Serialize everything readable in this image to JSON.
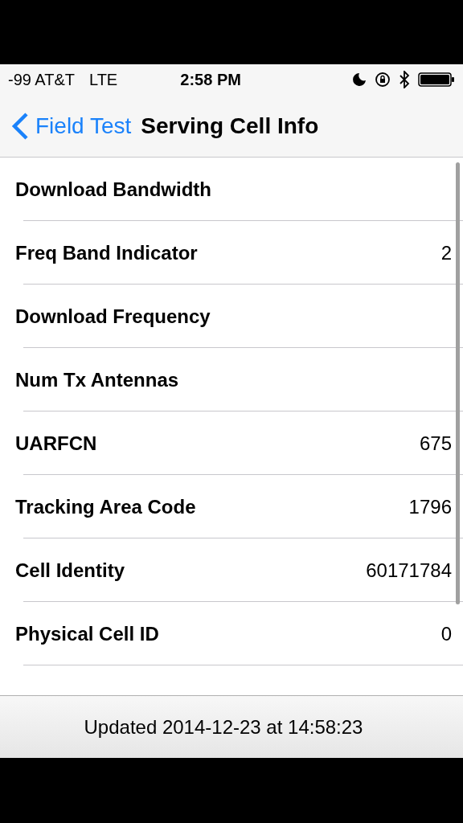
{
  "status_bar": {
    "carrier": "-99 AT&T",
    "network": "LTE",
    "time": "2:58 PM"
  },
  "nav_bar": {
    "back_label": "Field Test",
    "title": "Serving Cell Info"
  },
  "rows": [
    {
      "label": "Download Bandwidth"
    },
    {
      "label": "Freq Band Indicator",
      "value": "2"
    },
    {
      "label": "Download Frequency"
    },
    {
      "label": "Num Tx Antennas"
    },
    {
      "label": "UARFCN",
      "value": "675"
    },
    {
      "label": "Tracking Area Code",
      "value": "1796"
    },
    {
      "label": "Cell Identity",
      "value": "60171784"
    },
    {
      "label": "Physical Cell ID",
      "value": "0"
    }
  ],
  "footer": {
    "text": "Updated 2014-12-23 at 14:58:23"
  }
}
